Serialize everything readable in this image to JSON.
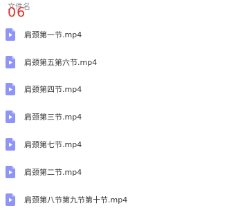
{
  "header": {
    "column_name_label": "文件名",
    "overlay_number": "06"
  },
  "file_icon": {
    "name": "video-file-icon",
    "color": "#8f95f5",
    "play_color": "#ffffff"
  },
  "files": [
    {
      "name": "肩颈第一节.mp4"
    },
    {
      "name": "肩颈第五第六节.mp4"
    },
    {
      "name": "肩颈第四节.mp4"
    },
    {
      "name": "肩颈第三节.mp4"
    },
    {
      "name": "肩颈第七节.mp4"
    },
    {
      "name": "肩颈第二节.mp4"
    },
    {
      "name": "肩颈第八节第九节第十节.mp4"
    }
  ]
}
